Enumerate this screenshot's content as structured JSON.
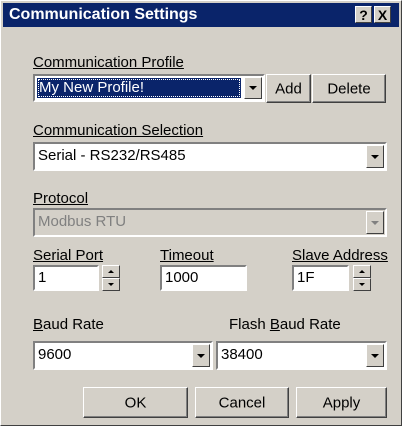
{
  "dialog": {
    "title": "Communication Settings",
    "help_label": "?",
    "close_label": "X"
  },
  "profile": {
    "label": "Communication Profile",
    "value": "My New Profile!",
    "add_label": "Add",
    "delete_label": "Delete"
  },
  "selection": {
    "label": "Communication Selection",
    "value": "Serial - RS232/RS485"
  },
  "protocol": {
    "label": "Protocol",
    "value": "Modbus RTU"
  },
  "serial_port": {
    "label": "Serial Port",
    "value": "1"
  },
  "timeout": {
    "label": "Timeout",
    "value": "1000"
  },
  "slave_address": {
    "label": "Slave Address",
    "value": "1F"
  },
  "baud_rate": {
    "label_first": "B",
    "label_rest": "aud Rate",
    "value": "9600"
  },
  "flash_baud_rate": {
    "label_prefix": "Flash ",
    "label_first": "B",
    "label_rest": "aud Rate",
    "value": "38400"
  },
  "buttons": {
    "ok": "OK",
    "cancel": "Cancel",
    "apply": "Apply"
  },
  "colors": {
    "face": "#d4d0c8",
    "titlebar": "#0a246a",
    "selection": "#0a246a"
  }
}
